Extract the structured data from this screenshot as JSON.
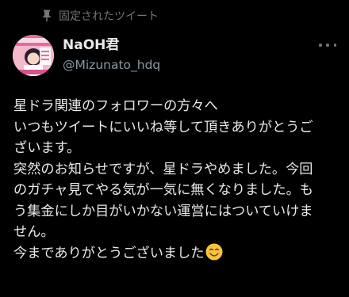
{
  "pinned": {
    "label": "固定されたツイート",
    "icon": "pin-icon"
  },
  "author": {
    "display_name": "NaOH君",
    "handle": "@Mizunato_hdq",
    "avatar_icon": "avatar-icon"
  },
  "more_icon": "more-horizontal-icon",
  "tweet": {
    "lines": [
      "星ドラ関連のフォロワーの方々へ",
      "いつもツイートにいいね等して頂きありがとうご",
      "ざいます。",
      "突然のお知らせですが、星ドラやめました。今回",
      "のガチャ見てやる気が一気に無くなりました。も",
      "う集金にしか目がいかない運営にはついていけま",
      "せん。",
      "今までありがとうございました"
    ],
    "trailing_emoji": "smiling-face-emoji"
  },
  "colors": {
    "background": "#000000",
    "text_primary": "#e7e9ea",
    "text_secondary": "#71767b",
    "handle": "#8b98a5",
    "emoji_yellow": "#f9c43c"
  }
}
